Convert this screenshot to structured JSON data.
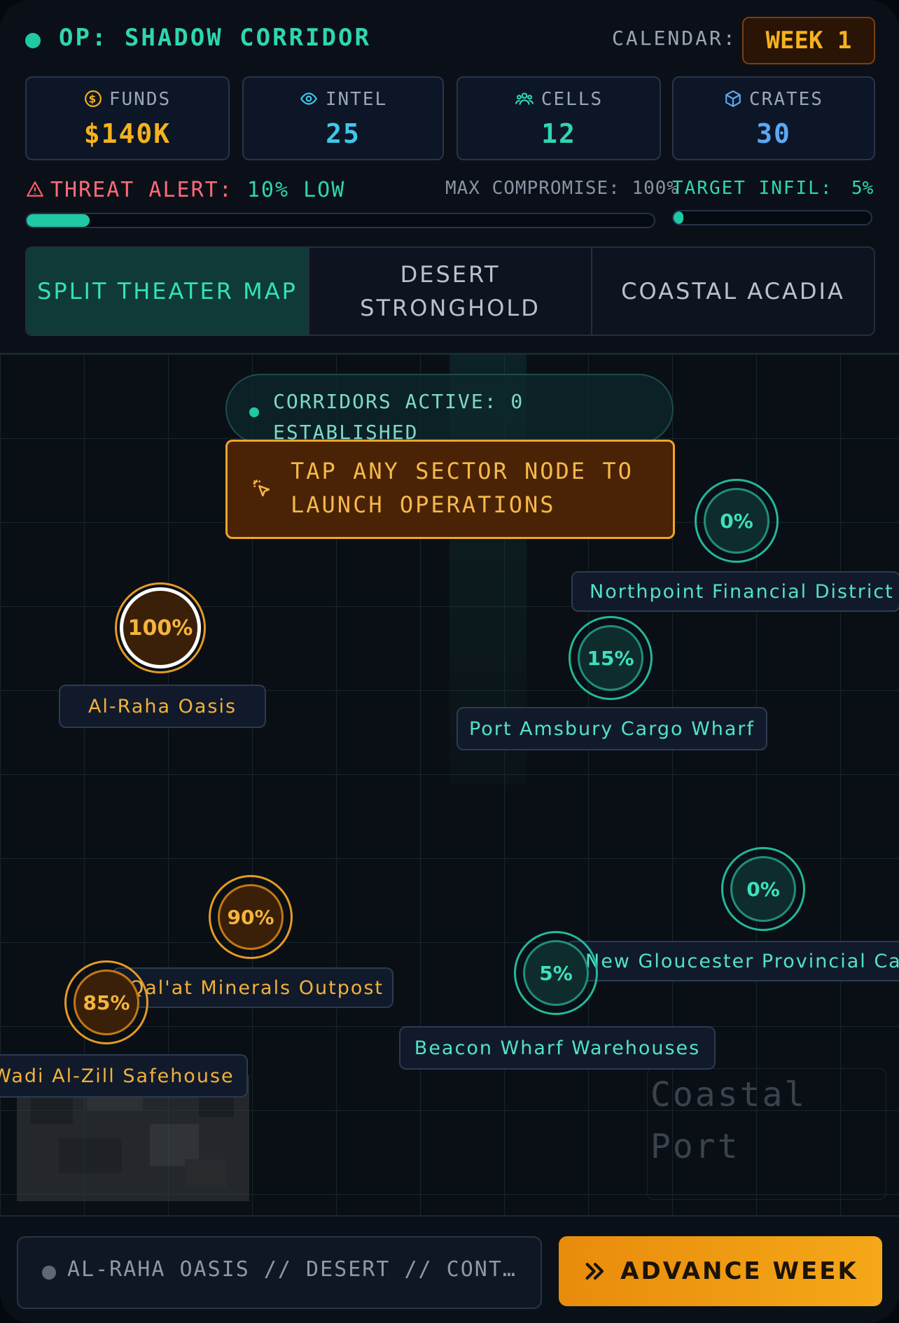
{
  "header": {
    "title": "OP: SHADOW CORRIDOR",
    "calendar_label": "CALENDAR:",
    "week": "WEEK 1"
  },
  "stats": [
    {
      "label": "FUNDS",
      "value": "$140K",
      "icon": "dollar-coin-icon",
      "color": "#f5b21c"
    },
    {
      "label": "INTEL",
      "value": "25",
      "icon": "eye-icon",
      "color": "#3ec9ea"
    },
    {
      "label": "CELLS",
      "value": "12",
      "icon": "users-icon",
      "color": "#2fd6b0"
    },
    {
      "label": "CRATES",
      "value": "30",
      "icon": "box-icon",
      "color": "#5ba8f5"
    }
  ],
  "threat": {
    "label": "THREAT ALERT:",
    "value": "10% LOW",
    "level": 0.1,
    "max_compromise": "MAX COMPROMISE: 100%",
    "target_label": "TARGET INFIL:",
    "target_value": "5%",
    "target_level": 0.05
  },
  "tabs": [
    {
      "label": "SPLIT THEATER MAP",
      "active": true
    },
    {
      "label": "DESERT STRONGHOLD",
      "active": false
    },
    {
      "label": "COASTAL ACADIA",
      "active": false
    }
  ],
  "map": {
    "corridors": "CORRIDORS ACTIVE: 0 ESTABLISHED",
    "hint": "TAP ANY SECTOR NODE TO LAUNCH OPERATIONS",
    "nodes": [
      {
        "pct": "0%",
        "name": "Northpoint Financial District",
        "theme": "teal"
      },
      {
        "pct": "100%",
        "name": "Al-Raha Oasis",
        "theme": "orange"
      },
      {
        "pct": "15%",
        "name": "Port Amsbury Cargo Wharf",
        "theme": "teal"
      },
      {
        "pct": "0%",
        "name": "New Gloucester Provincial Cap",
        "theme": "teal"
      },
      {
        "pct": "90%",
        "name": "Qal'at Minerals Outpost",
        "theme": "orange"
      },
      {
        "pct": "5%",
        "name": "Beacon Wharf Warehouses",
        "theme": "teal"
      },
      {
        "pct": "85%",
        "name": "Wadi Al-Zill Safehouse",
        "theme": "orange"
      }
    ],
    "coastal_placeholder": "Coastal Port"
  },
  "footer": {
    "status": "AL-RAHA OASIS // DESERT // CONT…",
    "advance_label": "ADVANCE WEEK"
  }
}
